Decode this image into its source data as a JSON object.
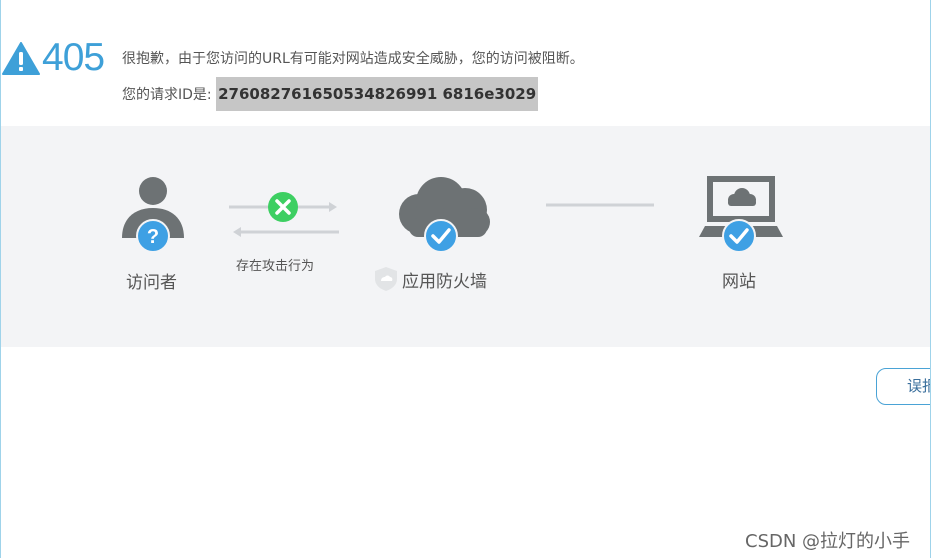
{
  "error": {
    "code": "405",
    "message": "很抱歉，由于您访问的URL有可能对网站造成安全威胁，您的访问被阻断。",
    "request_id_label": "您的请求ID是: ",
    "request_id": "276082761650534826991 6816e3029"
  },
  "flow": {
    "visitor_label": "访问者",
    "attack_label": "存在攻击行为",
    "firewall_label": "应用防火墙",
    "website_label": "网站"
  },
  "actions": {
    "feedback_label": "误报"
  },
  "watermark": "CSDN @拉灯的小手",
  "colors": {
    "accent_blue": "#3ea0d8",
    "icon_gray": "#6d7274",
    "check_blue": "#3ea0e4",
    "block_green": "#3dcf62",
    "band_bg": "#f3f4f6"
  }
}
